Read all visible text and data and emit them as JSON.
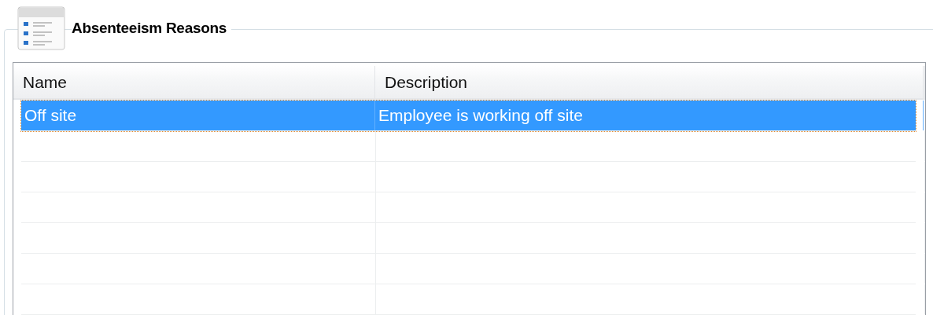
{
  "group": {
    "title": "Absenteeism Reasons"
  },
  "table": {
    "columns": [
      "Name",
      "Description"
    ],
    "rows": [
      {
        "cells": [
          "Off site",
          "Employee is working off site"
        ],
        "selected": true
      }
    ]
  }
}
